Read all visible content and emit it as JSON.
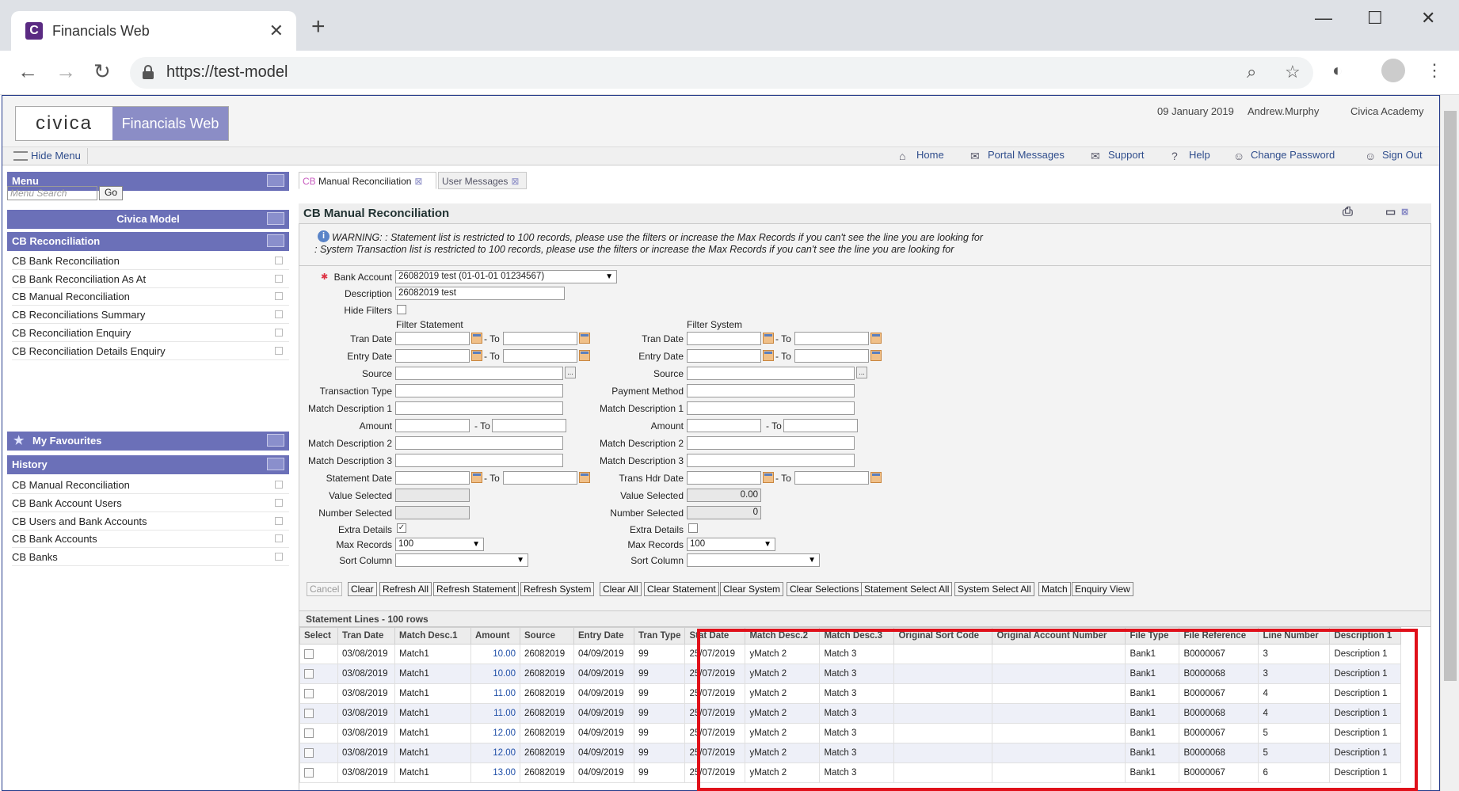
{
  "browser": {
    "tab_title": "Financials Web",
    "url": "https://test-model"
  },
  "header": {
    "logo_left": "civica",
    "logo_right": "Financials Web",
    "date": "09 January 2019",
    "user": "Andrew.Murphy",
    "org": "Civica Academy"
  },
  "menubar": {
    "hide_menu": "Hide Menu",
    "home": "Home",
    "portal_messages": "Portal Messages",
    "support": "Support",
    "help": "Help",
    "change_password": "Change Password",
    "sign_out": "Sign Out"
  },
  "sidebar": {
    "menu_title": "Menu",
    "search_placeholder": "Menu Search",
    "go": "Go",
    "group_title": "Civica Model",
    "section_title": "CB Reconciliation",
    "items": [
      "CB Bank Reconciliation",
      "CB Bank Reconciliation As At",
      "CB Manual Reconciliation",
      "CB Reconciliations Summary",
      "CB Reconciliation Enquiry",
      "CB Reconciliation Details Enquiry"
    ],
    "favourites_title": "My Favourites",
    "history_title": "History",
    "history": [
      "CB Manual Reconciliation",
      "CB Bank Account Users",
      "CB Users and Bank Accounts",
      "CB Bank Accounts",
      "CB Banks"
    ]
  },
  "tabs": {
    "active_prefix": "CB",
    "active_label": "Manual Reconciliation",
    "second": "User Messages"
  },
  "page": {
    "title": "CB Manual Reconciliation",
    "warning1": "WARNING: : Statement list is restricted to 100 records, please use the filters or increase the Max Records if you can't see the line you are looking for",
    "warning2": ": System Transaction list is restricted to 100 records, please use the filters or increase the Max Records if you can't see the line you are looking for"
  },
  "form": {
    "bank_account_label": "Bank Account",
    "bank_account_value": "26082019 test (01-01-01 01234567)",
    "description_label": "Description",
    "description_value": "26082019 test",
    "hide_filters_label": "Hide Filters",
    "filter_statement": "Filter Statement",
    "filter_system": "Filter System",
    "tran_date": "Tran Date",
    "entry_date": "Entry Date",
    "source": "Source",
    "transaction_type": "Transaction Type",
    "payment_method": "Payment Method",
    "match_desc_1": "Match Description 1",
    "amount": "Amount",
    "match_desc_2": "Match Description 2",
    "match_desc_3": "Match Description 3",
    "statement_date": "Statement Date",
    "trans_hdr_date": "Trans Hdr Date",
    "value_selected": "Value Selected",
    "number_selected": "Number Selected",
    "sys_value_selected": "0.00",
    "sys_number_selected": "0",
    "extra_details": "Extra Details",
    "max_records": "Max Records",
    "max_records_value": "100",
    "sort_column": "Sort Column",
    "to": "- To"
  },
  "buttons": [
    "Cancel",
    "Clear",
    "Refresh All",
    "Refresh Statement",
    "Refresh System",
    "Clear All",
    "Clear Statement",
    "Clear System",
    "Clear Selections",
    "Statement Select All",
    "System Select All",
    "Match",
    "Enquiry View"
  ],
  "grid": {
    "title": "Statement Lines - 100 rows",
    "columns": [
      "Select",
      "Tran Date",
      "Match Desc.1",
      "Amount",
      "Source",
      "Entry Date",
      "Tran Type",
      "Stat Date",
      "Match Desc.2",
      "Match Desc.3",
      "Original Sort Code",
      "Original Account Number",
      "File Type",
      "File Reference",
      "Line Number",
      "Description 1"
    ],
    "rows": [
      [
        "",
        "03/08/2019",
        "Match1",
        "10.00",
        "26082019",
        "04/09/2019",
        "99",
        "25/07/2019",
        "yMatch 2",
        "Match 3",
        "",
        "",
        "Bank1",
        "B0000067",
        "3",
        "Description 1"
      ],
      [
        "",
        "03/08/2019",
        "Match1",
        "10.00",
        "26082019",
        "04/09/2019",
        "99",
        "25/07/2019",
        "yMatch 2",
        "Match 3",
        "",
        "",
        "Bank1",
        "B0000068",
        "3",
        "Description 1"
      ],
      [
        "",
        "03/08/2019",
        "Match1",
        "11.00",
        "26082019",
        "04/09/2019",
        "99",
        "25/07/2019",
        "yMatch 2",
        "Match 3",
        "",
        "",
        "Bank1",
        "B0000067",
        "4",
        "Description 1"
      ],
      [
        "",
        "03/08/2019",
        "Match1",
        "11.00",
        "26082019",
        "04/09/2019",
        "99",
        "25/07/2019",
        "yMatch 2",
        "Match 3",
        "",
        "",
        "Bank1",
        "B0000068",
        "4",
        "Description 1"
      ],
      [
        "",
        "03/08/2019",
        "Match1",
        "12.00",
        "26082019",
        "04/09/2019",
        "99",
        "25/07/2019",
        "yMatch 2",
        "Match 3",
        "",
        "",
        "Bank1",
        "B0000067",
        "5",
        "Description 1"
      ],
      [
        "",
        "03/08/2019",
        "Match1",
        "12.00",
        "26082019",
        "04/09/2019",
        "99",
        "25/07/2019",
        "yMatch 2",
        "Match 3",
        "",
        "",
        "Bank1",
        "B0000068",
        "5",
        "Description 1"
      ],
      [
        "",
        "03/08/2019",
        "Match1",
        "13.00",
        "26082019",
        "04/09/2019",
        "99",
        "25/07/2019",
        "yMatch 2",
        "Match 3",
        "",
        "",
        "Bank1",
        "B0000067",
        "6",
        "Description 1"
      ]
    ]
  },
  "colors": {
    "accent": "#6b70b8",
    "highlight": "#e0101a",
    "link": "#2f4d8c"
  }
}
